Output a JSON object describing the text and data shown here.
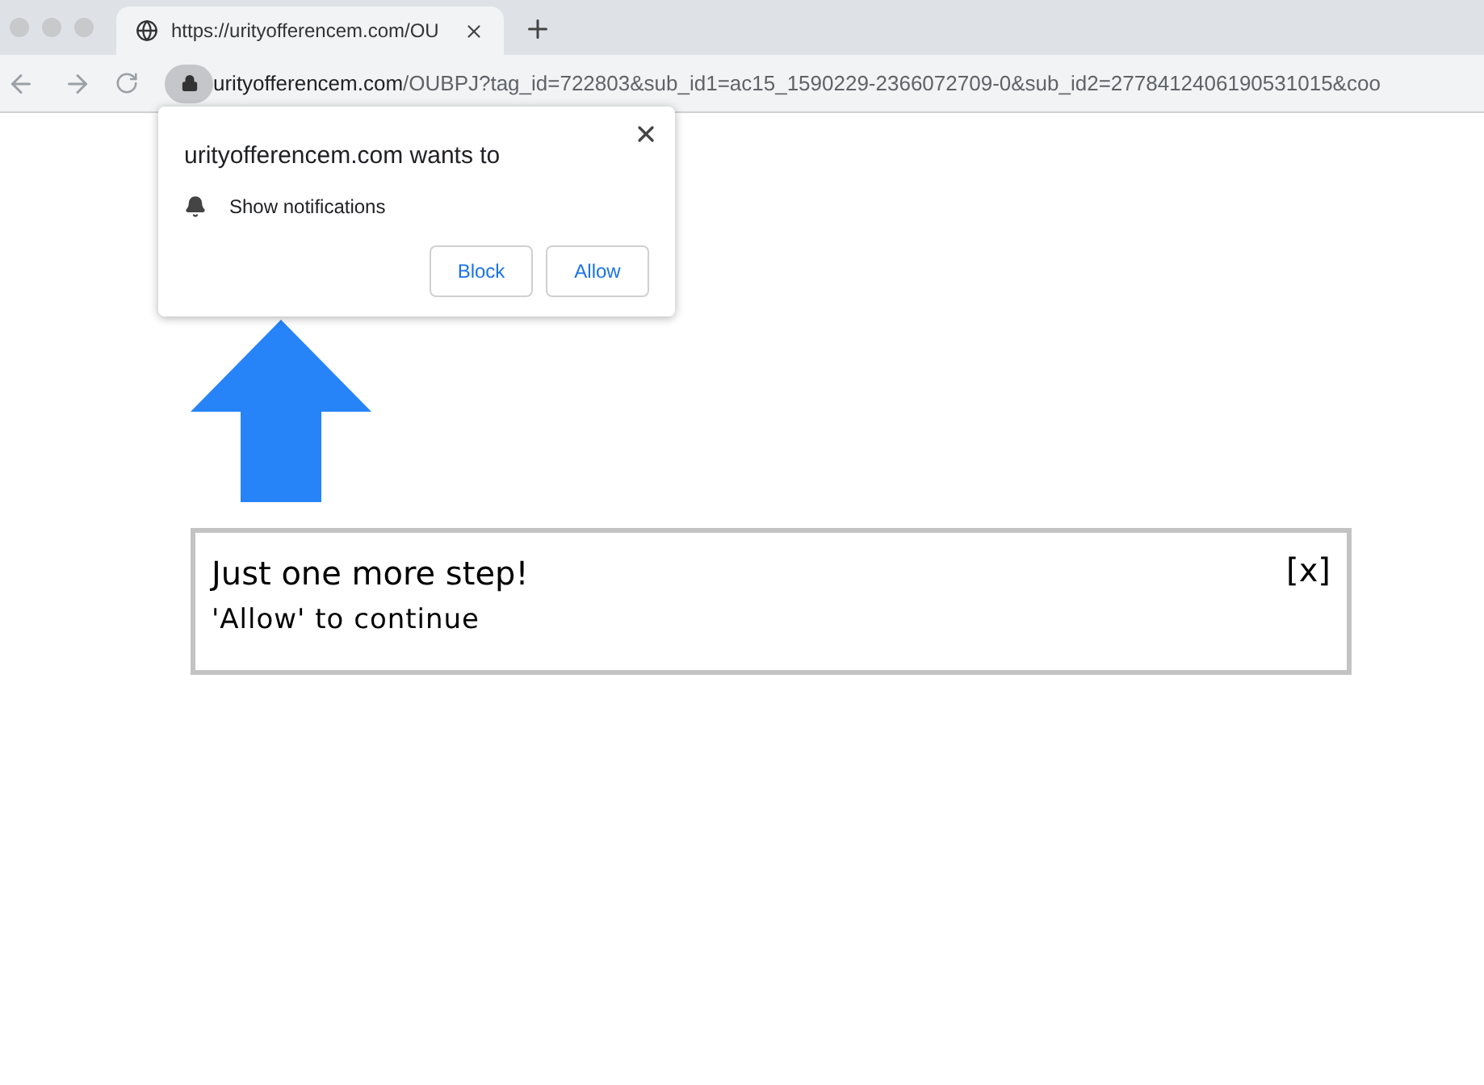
{
  "tab": {
    "title": "https://urityofferencem.com/OU"
  },
  "address_bar": {
    "host": "urityofferencem.com",
    "path": "/OUBPJ?tag_id=722803&sub_id1=ac15_1590229-2366072709-0&sub_id2=2778412406190531015&coo"
  },
  "permission_popup": {
    "title": "urityofferencem.com wants to",
    "permission": "Show notifications",
    "buttons": [
      "Block",
      "Allow"
    ]
  },
  "message_box": {
    "heading": "Just one more step!",
    "text": "'Allow' to continue",
    "close": "[x]"
  }
}
